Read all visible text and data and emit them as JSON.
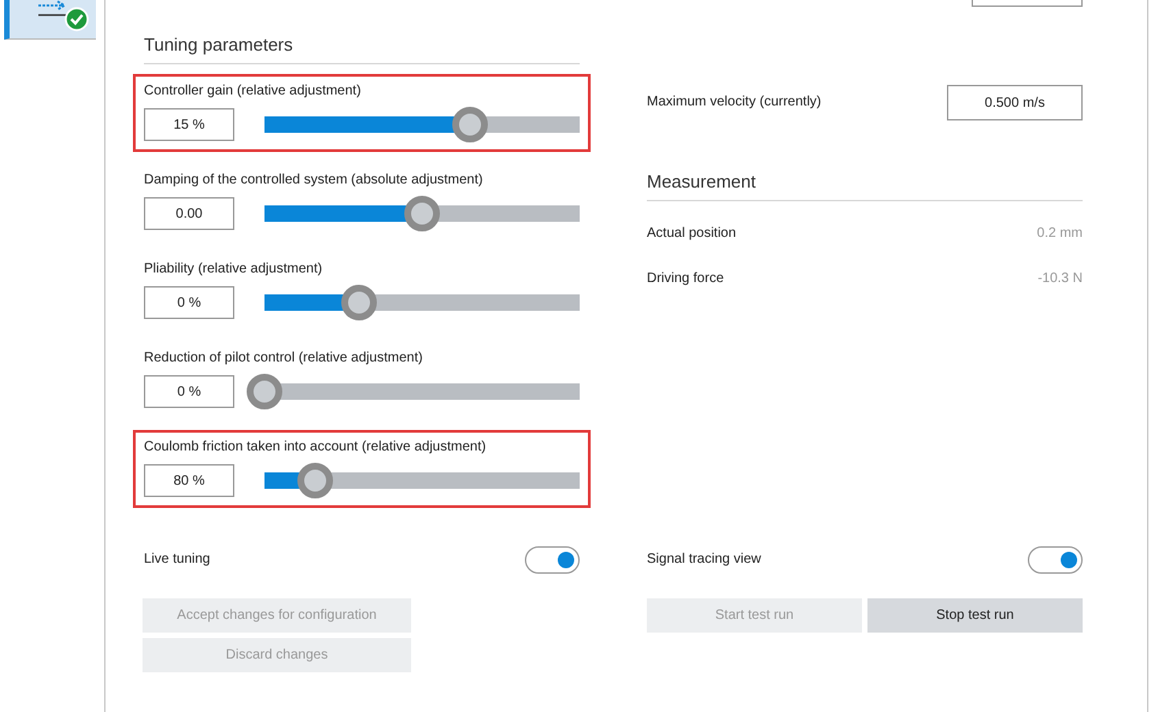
{
  "tuning": {
    "title": "Tuning parameters",
    "parameters": [
      {
        "label": "Controller gain (relative adjustment)",
        "value": "15 %",
        "level": 0.65,
        "highlighted": true
      },
      {
        "label": "Damping of the controlled system (absolute adjustment)",
        "value": "0.00",
        "level": 0.5,
        "highlighted": false
      },
      {
        "label": "Pliability (relative adjustment)",
        "value": "0 %",
        "level": 0.3,
        "highlighted": false
      },
      {
        "label": "Reduction of pilot control (relative adjustment)",
        "value": "0 %",
        "level": 0,
        "highlighted": false
      },
      {
        "label": "Coulomb friction taken into account (relative adjustment)",
        "value": "80 %",
        "level": 0.16,
        "highlighted": true
      }
    ]
  },
  "max_velocity": {
    "label": "Maximum velocity (currently)",
    "value": "0.500 m/s"
  },
  "measurement": {
    "title": "Measurement",
    "rows": [
      {
        "label": "Actual position",
        "value": "0.2 mm"
      },
      {
        "label": "Driving force",
        "value": "-10.3 N"
      }
    ]
  },
  "live_tuning": {
    "label": "Live tuning",
    "on": true
  },
  "signal_tracing": {
    "label": "Signal tracing view",
    "on": true
  },
  "left_buttons": [
    {
      "label": "Accept changes for configuration",
      "disabled": true
    },
    {
      "label": "Discard changes",
      "disabled": true
    }
  ],
  "right_buttons": [
    {
      "label": "Start test run",
      "disabled": true
    },
    {
      "label": "Stop test run",
      "disabled": false
    }
  ]
}
